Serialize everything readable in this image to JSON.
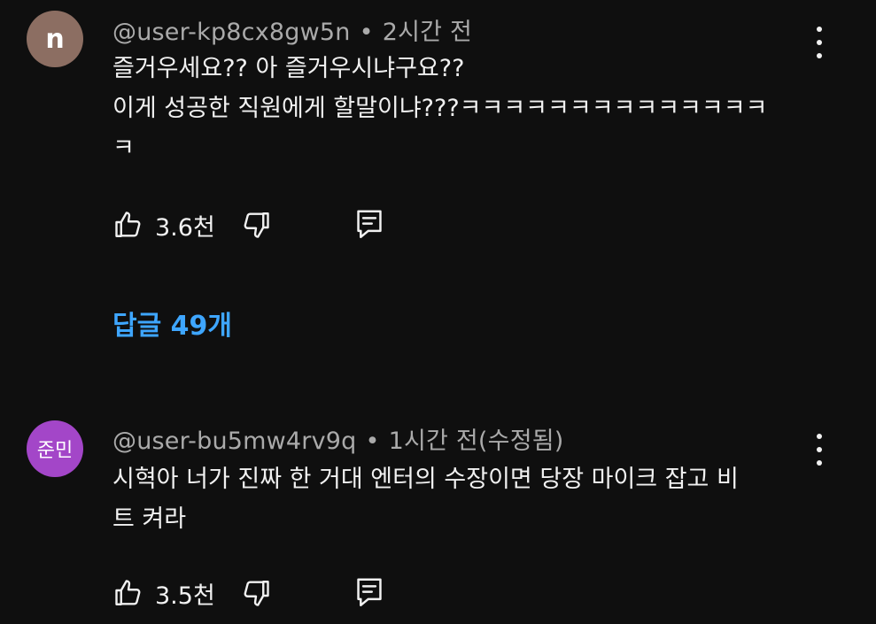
{
  "comments": [
    {
      "avatar_letter": "n",
      "avatar_color": "#8c6e62",
      "username": "@user-kp8cx8gw5n",
      "separator": "•",
      "time": "2시간 전",
      "lines": [
        "즐거우세요?? 아 즐거우시냐구요??",
        "이게 성공한 직원에게 할말이냐???ㅋㅋㅋㅋㅋㅋㅋㅋㅋㅋㅋㅋㅋㅋ",
        "ㅋ"
      ],
      "like_count": "3.6천"
    },
    {
      "avatar_letter": "준민",
      "avatar_color": "#a346c8",
      "username": "@user-bu5mw4rv9q",
      "separator": "•",
      "time": "1시간 전(수정됨)",
      "lines": [
        "시혁아 너가 진짜 한 거대 엔터의 수장이면 당장 마이크 잡고 비",
        "트 켜라"
      ],
      "like_count": "3.5천"
    }
  ],
  "replies_label": "답글 49개",
  "colors": {
    "background": "#0f0f0f",
    "text": "#f1f1f1",
    "meta": "#aaaaaa",
    "link": "#3ea6ff"
  },
  "icons": [
    "like-icon",
    "dislike-icon",
    "reply-icon",
    "more-options-icon"
  ]
}
